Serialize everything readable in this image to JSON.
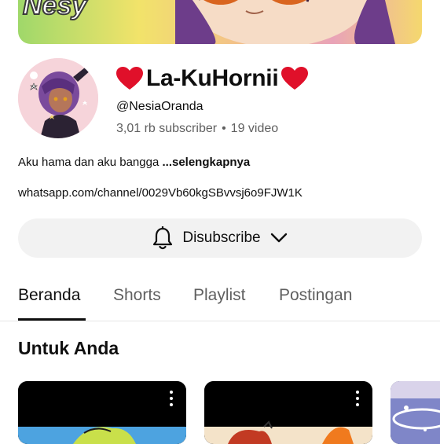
{
  "banner": {
    "text": "Nesy"
  },
  "channel": {
    "name": "La-KuHornii",
    "handle": "@NesiaOranda",
    "subscribers": "3,01 rb subscriber",
    "separator": "•",
    "videos": "19 video",
    "description": "Aku hama dan aku bangga",
    "more_label": "...selengkapnya",
    "link": "whatsapp.com/channel/0029Vb60kgSBvvsj6o9FJW1K"
  },
  "subscribe_button": {
    "label": "Disubscribe",
    "icon": "bell-icon"
  },
  "tabs": [
    {
      "label": "Beranda",
      "active": true
    },
    {
      "label": "Shorts",
      "active": false
    },
    {
      "label": "Playlist",
      "active": false
    },
    {
      "label": "Postingan",
      "active": false
    }
  ],
  "section": {
    "title": "Untuk Anda"
  },
  "colors": {
    "heart": "#e0102a",
    "tab_active": "#0f0f0f",
    "tab_inactive": "#606060",
    "button_bg": "#f2f2f2"
  }
}
